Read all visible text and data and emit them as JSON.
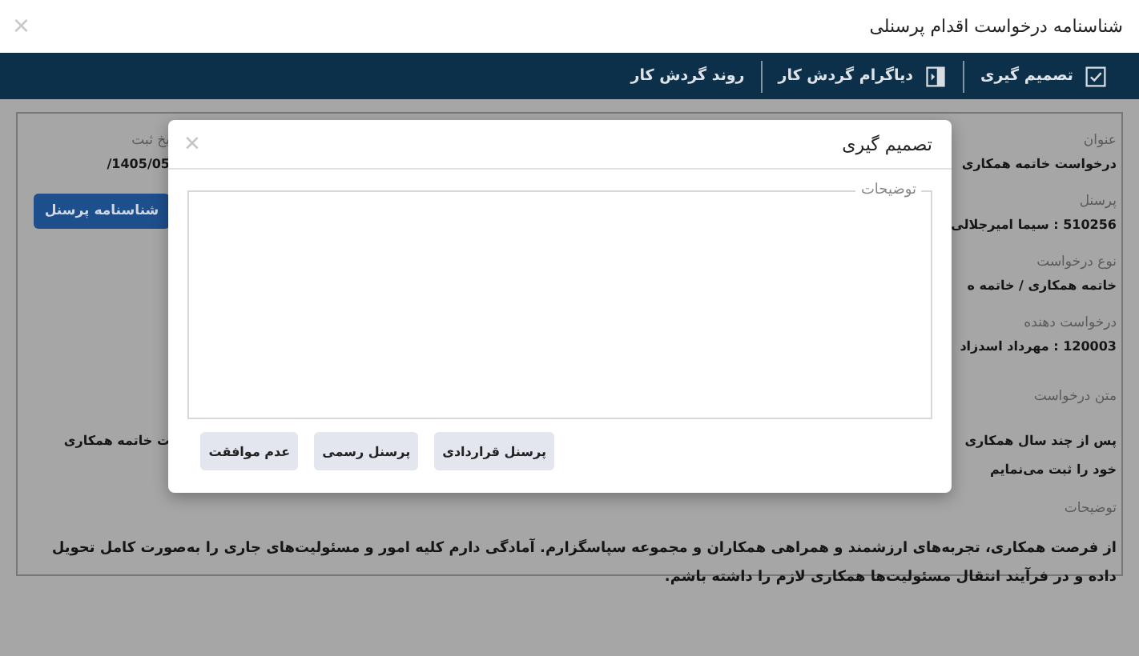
{
  "window": {
    "title": "شناسنامه درخواست اقدام پرسنلی",
    "close": "×"
  },
  "toolbar": [
    {
      "label": "تصمیم گیری",
      "kind": "checkbox"
    },
    {
      "label": "دیاگرام گردش کار",
      "kind": "sidebar"
    },
    {
      "label": "روند گردش کار",
      "kind": "plain"
    }
  ],
  "fields": [
    {
      "label": "عنوان",
      "value": "درخواست خاتمه همکاری"
    },
    {
      "label": "پرسنل",
      "value": "510256 : سیما امیرجلالی"
    },
    {
      "label": "نوع درخواست",
      "value": "خاتمه همکاری / خاتمه ه"
    },
    {
      "label": "درخواست دهنده",
      "value": "120003 : مهرداد اسدزاد"
    }
  ],
  "side": {
    "label": "یخ ثبت",
    "value": "1405/05/",
    "button": "شناسنامه پرسنل"
  },
  "request_text": {
    "label": "متن درخواست",
    "lines_right": [
      "پس از چند سال همکاری",
      "خود را ثبت می‌نمایم"
    ],
    "line_left": "ت خاتمه همکاری"
  },
  "notes": {
    "label": "توضیحات",
    "text": "از فرصت همکاری، تجربه‌های ارزشمند و همراهی همکاران و مجموعه سپاسگزارم. آمادگی دارم کلیه امور و مسئولیت‌های جاری را به‌صورت کامل تحویل داده و در فرآیند انتقال مسئولیت‌ها همکاری لازم را داشته باشم."
  },
  "dialog": {
    "title": "تصمیم گیری",
    "close": "×",
    "field": {
      "legend": "توضیحات"
    },
    "buttons": [
      "پرسنل قراردادی",
      "پرسنل رسمی",
      "عدم موافقت"
    ]
  }
}
